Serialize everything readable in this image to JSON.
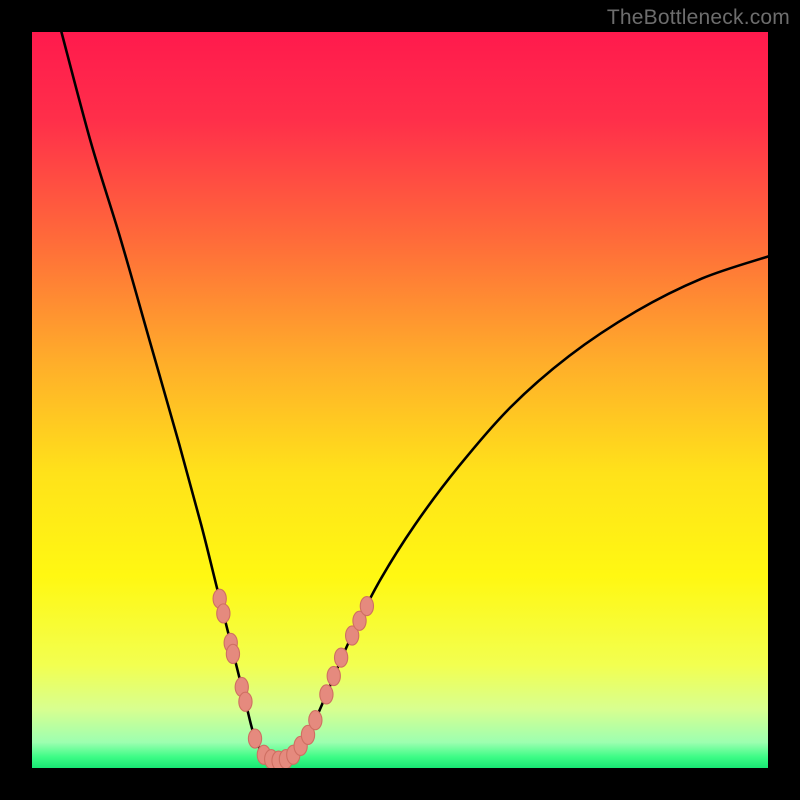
{
  "watermark": "TheBottleneck.com",
  "colors": {
    "frame": "#000000",
    "gradient_stops": [
      {
        "offset": 0.0,
        "color": "#ff1a4d"
      },
      {
        "offset": 0.12,
        "color": "#ff2f4a"
      },
      {
        "offset": 0.28,
        "color": "#ff6a3a"
      },
      {
        "offset": 0.45,
        "color": "#ffae2a"
      },
      {
        "offset": 0.6,
        "color": "#ffe21a"
      },
      {
        "offset": 0.74,
        "color": "#fff812"
      },
      {
        "offset": 0.86,
        "color": "#f2ff50"
      },
      {
        "offset": 0.92,
        "color": "#d8ff90"
      },
      {
        "offset": 0.965,
        "color": "#9dffb0"
      },
      {
        "offset": 0.985,
        "color": "#3dfc86"
      },
      {
        "offset": 1.0,
        "color": "#18e673"
      }
    ],
    "curve": "#000000",
    "marker_fill": "#e58a7e",
    "marker_stroke": "#cf6f62"
  },
  "chart_data": {
    "type": "line",
    "title": "",
    "xlabel": "",
    "ylabel": "",
    "xlim": [
      0,
      100
    ],
    "ylim": [
      0,
      100
    ],
    "curve_points": [
      {
        "x": 4.0,
        "y": 100.0
      },
      {
        "x": 8.0,
        "y": 85.0
      },
      {
        "x": 12.0,
        "y": 72.0
      },
      {
        "x": 16.0,
        "y": 58.0
      },
      {
        "x": 20.0,
        "y": 44.0
      },
      {
        "x": 23.0,
        "y": 33.0
      },
      {
        "x": 25.0,
        "y": 25.0
      },
      {
        "x": 27.5,
        "y": 15.0
      },
      {
        "x": 29.0,
        "y": 9.0
      },
      {
        "x": 30.0,
        "y": 5.0
      },
      {
        "x": 31.0,
        "y": 2.5
      },
      {
        "x": 32.0,
        "y": 1.4
      },
      {
        "x": 33.5,
        "y": 1.0
      },
      {
        "x": 35.0,
        "y": 1.4
      },
      {
        "x": 36.5,
        "y": 3.0
      },
      {
        "x": 38.0,
        "y": 5.5
      },
      {
        "x": 40.0,
        "y": 10.0
      },
      {
        "x": 43.0,
        "y": 17.0
      },
      {
        "x": 47.0,
        "y": 25.0
      },
      {
        "x": 52.0,
        "y": 33.0
      },
      {
        "x": 58.0,
        "y": 41.0
      },
      {
        "x": 65.0,
        "y": 49.0
      },
      {
        "x": 73.0,
        "y": 56.0
      },
      {
        "x": 82.0,
        "y": 62.0
      },
      {
        "x": 91.0,
        "y": 66.5
      },
      {
        "x": 100.0,
        "y": 69.5
      }
    ],
    "markers": [
      {
        "x": 25.5,
        "y": 23.0
      },
      {
        "x": 26.0,
        "y": 21.0
      },
      {
        "x": 27.0,
        "y": 17.0
      },
      {
        "x": 27.3,
        "y": 15.5
      },
      {
        "x": 28.5,
        "y": 11.0
      },
      {
        "x": 29.0,
        "y": 9.0
      },
      {
        "x": 30.3,
        "y": 4.0
      },
      {
        "x": 31.5,
        "y": 1.8
      },
      {
        "x": 32.5,
        "y": 1.2
      },
      {
        "x": 33.5,
        "y": 1.0
      },
      {
        "x": 34.5,
        "y": 1.2
      },
      {
        "x": 35.5,
        "y": 1.8
      },
      {
        "x": 36.5,
        "y": 3.0
      },
      {
        "x": 37.5,
        "y": 4.5
      },
      {
        "x": 38.5,
        "y": 6.5
      },
      {
        "x": 40.0,
        "y": 10.0
      },
      {
        "x": 41.0,
        "y": 12.5
      },
      {
        "x": 42.0,
        "y": 15.0
      },
      {
        "x": 43.5,
        "y": 18.0
      },
      {
        "x": 44.5,
        "y": 20.0
      },
      {
        "x": 45.5,
        "y": 22.0
      }
    ]
  }
}
